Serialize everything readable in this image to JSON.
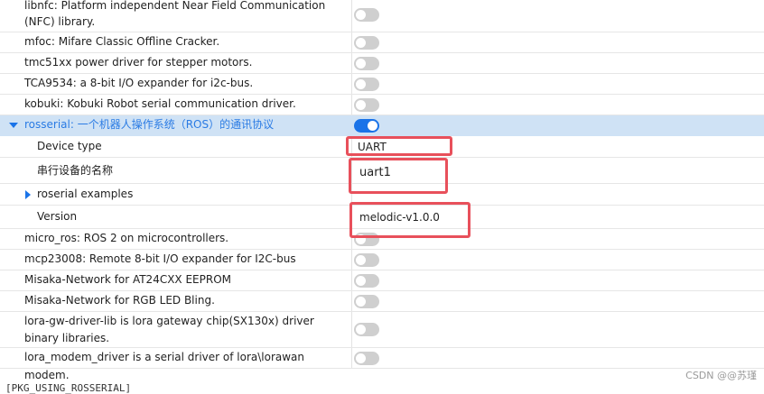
{
  "packages": [
    {
      "id": "libnfc",
      "label": "libnfc: Platform independent Near Field Communication (NFC) library.",
      "enabled": false
    },
    {
      "id": "mfoc",
      "label": "mfoc: Mifare Classic Offline Cracker.",
      "enabled": false
    },
    {
      "id": "tmc51xx",
      "label": "tmc51xx power driver for stepper motors.",
      "enabled": false
    },
    {
      "id": "tca9534",
      "label": "TCA9534: a 8-bit I/O expander for i2c-bus.",
      "enabled": false
    },
    {
      "id": "kobuki",
      "label": "kobuki: Kobuki Robot serial communication driver.",
      "enabled": false
    }
  ],
  "rosserial": {
    "label": "rosserial: 一个机器人操作系统（ROS）的通讯协议",
    "enabled": true,
    "device_type_label": "Device type",
    "device_type_value": "UART",
    "serial_name_label": "串行设备的名称",
    "serial_name_value": "uart1",
    "examples_label": "roserial examples",
    "version_label": "Version",
    "version_value": "melodic-v1.0.0"
  },
  "packages_after": [
    {
      "id": "micro_ros",
      "label": "micro_ros: ROS 2 on microcontrollers.",
      "enabled": false
    },
    {
      "id": "mcp23008",
      "label": "mcp23008: Remote 8-bit I/O expander for I2C-bus",
      "enabled": false
    },
    {
      "id": "misaka_eeprom",
      "label": "Misaka-Network for AT24CXX EEPROM",
      "enabled": false
    },
    {
      "id": "misaka_led",
      "label": "Misaka-Network for RGB LED Bling.",
      "enabled": false
    },
    {
      "id": "lora_gw",
      "label": "lora-gw-driver-lib is lora gateway chip(SX130x) driver binary libraries.",
      "enabled": false
    },
    {
      "id": "lora_modem",
      "label": "lora_modem_driver is a serial driver of lora\\lorawan modem.",
      "enabled": false
    }
  ],
  "footer": {
    "bottom_text": "[PKG_USING_ROSSERIAL]",
    "watermark": "CSDN @@苏瑾"
  },
  "colors": {
    "accent": "#1a73e8",
    "highlight": "#cfe2f5",
    "annotation": "#e8505b"
  }
}
